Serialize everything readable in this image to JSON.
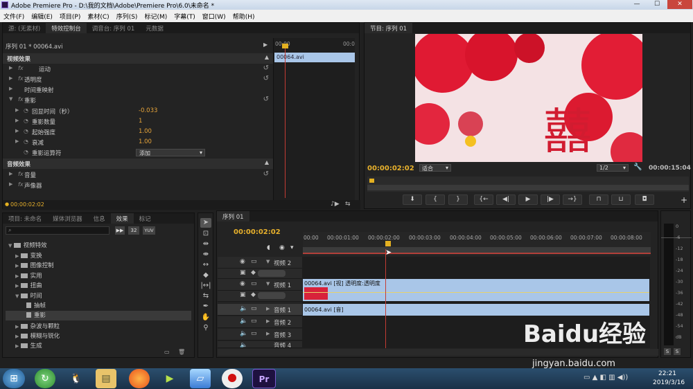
{
  "window": {
    "title": "Adobe Premiere Pro - D:\\我的文档\\Adobe\\Premiere Pro\\6.0\\未命名 *"
  },
  "menu": [
    "文件(F)",
    "编辑(E)",
    "项目(P)",
    "素材(C)",
    "序列(S)",
    "标记(M)",
    "字幕(T)",
    "窗口(W)",
    "帮助(H)"
  ],
  "source_panel": {
    "tabs": [
      "源: (无素材)",
      "特效控制台",
      "调音台: 序列 01",
      "元数据"
    ],
    "sequence_label": "序列 01 * 00064.avi",
    "timeline_ruler": [
      "00:00",
      "00:0"
    ],
    "clip_name": "00064.avi",
    "current_time": "00:00:02:02",
    "video_effects_header": "视频效果",
    "audio_effects_header": "音频效果",
    "effects": [
      {
        "label": "运动",
        "level": 0
      },
      {
        "label": "透明度",
        "level": 0
      },
      {
        "label": "时间重映射",
        "level": 0
      },
      {
        "label": "重影",
        "level": 0
      }
    ],
    "params": [
      {
        "label": "回显时间（秒）",
        "value": "-0.033"
      },
      {
        "label": "重影数量",
        "value": "1"
      },
      {
        "label": "起始强度",
        "value": "1.00"
      },
      {
        "label": "衰减",
        "value": "1.00"
      },
      {
        "label": "重影运算符",
        "value": "添加"
      }
    ],
    "audio_effects": [
      "音量",
      "声像器"
    ]
  },
  "program_monitor": {
    "tab": "节目: 序列 01",
    "current_time": "00:00:02:02",
    "fit": "适合",
    "quality": "1/2",
    "duration": "00:00:15:04"
  },
  "project_panel": {
    "tabs": [
      "项目: 未命名",
      "媒体浏览器",
      "信息",
      "效果",
      "标记"
    ],
    "badges": [
      "32",
      "YUV"
    ],
    "tree": [
      {
        "label": "视频特效",
        "indent": 0,
        "open": true
      },
      {
        "label": "变换",
        "indent": 1
      },
      {
        "label": "图像控制",
        "indent": 1
      },
      {
        "label": "实用",
        "indent": 1
      },
      {
        "label": "扭曲",
        "indent": 1
      },
      {
        "label": "时间",
        "indent": 1,
        "open": true
      },
      {
        "label": "抽帧",
        "indent": 2
      },
      {
        "label": "重影",
        "indent": 2,
        "selected": true
      },
      {
        "label": "杂波与颗粒",
        "indent": 1
      },
      {
        "label": "模糊与锐化",
        "indent": 1
      },
      {
        "label": "生成",
        "indent": 1
      }
    ]
  },
  "timeline": {
    "tab": "序列 01",
    "current_time": "00:00:02:02",
    "ruler": [
      "00:00",
      "00:00:01:00",
      "00:00:02:00",
      "00:00:03:00",
      "00:00:04:00",
      "00:00:05:00",
      "00:00:06:00",
      "00:00:07:00",
      "00:00:08:00"
    ],
    "tracks": [
      {
        "name": "视频 2",
        "type": "video"
      },
      {
        "name": "视频 1",
        "type": "video",
        "clip": "00064.avi [视] 透明度:透明度"
      },
      {
        "name": "音频 1",
        "type": "audio",
        "clip": "00064.avi [音]"
      },
      {
        "name": "音频 2",
        "type": "audio"
      },
      {
        "name": "音频 3",
        "type": "audio"
      },
      {
        "name": "音频 4",
        "type": "audio"
      }
    ]
  },
  "audio_meter": {
    "labels": [
      "0",
      "-6",
      "-12",
      "-18",
      "-24",
      "-30",
      "-36",
      "-42",
      "-48",
      "-54",
      "dB"
    ],
    "solo": [
      "S",
      "S"
    ]
  },
  "watermark": {
    "text": "Baidu经验",
    "url": "jingyan.baidu.com"
  },
  "taskbar": {
    "time": "22:21",
    "date": "2019/3/16",
    "pr_label": "Pr"
  }
}
